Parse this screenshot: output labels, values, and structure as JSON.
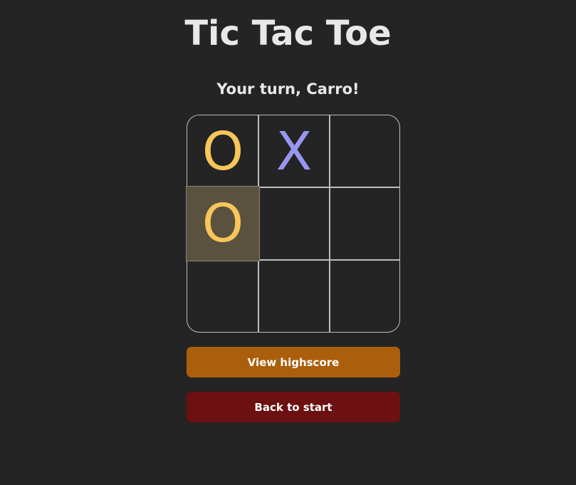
{
  "title": "Tic Tac Toe",
  "status": "Your turn, Carro!",
  "board": {
    "cells": [
      "O",
      "X",
      "",
      "O",
      "",
      "",
      "",
      "",
      ""
    ],
    "highlighted_cell": 3
  },
  "buttons": {
    "highscore_label": "View highscore",
    "start_label": "Back to start"
  },
  "colors": {
    "background": "#242424",
    "o_mark": "#f8c55a",
    "x_mark": "#9797f2",
    "highscore_button": "#ab5f0c",
    "start_button": "#6c1011",
    "highlight": "#5a513f"
  }
}
